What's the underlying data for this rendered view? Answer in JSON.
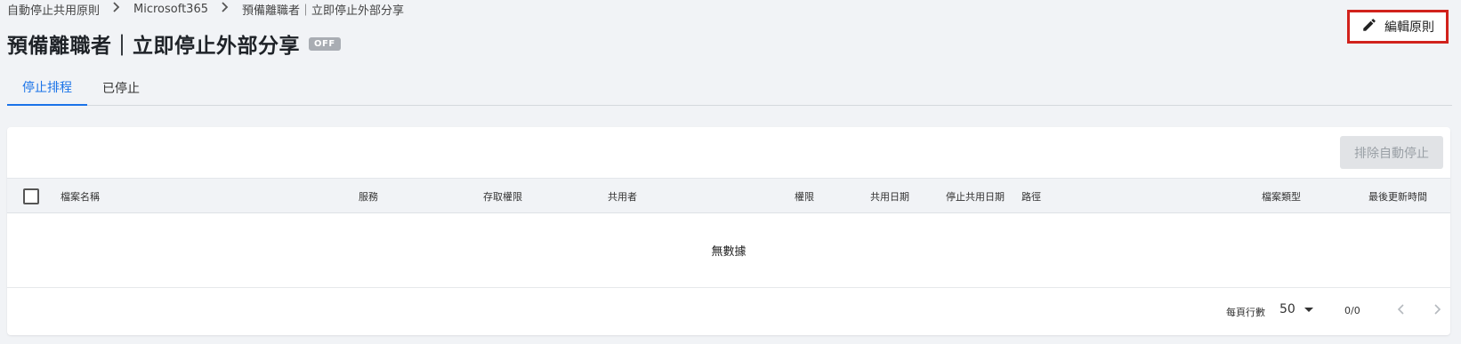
{
  "breadcrumb": {
    "items": [
      "自動停止共用原則",
      "Microsoft365",
      "預備離職者｜立即停止外部分享"
    ]
  },
  "header": {
    "title": "預備離職者｜立即停止外部分享",
    "status_badge": "OFF",
    "edit_button_label": "編輯原則"
  },
  "tabs": [
    {
      "label": "停止排程",
      "active": true
    },
    {
      "label": "已停止",
      "active": false
    }
  ],
  "toolbar": {
    "exclude_button_label": "排除自動停止"
  },
  "table": {
    "columns": [
      "檔案名稱",
      "服務",
      "存取權限",
      "共用者",
      "權限",
      "共用日期",
      "停止共用日期",
      "路徑",
      "檔案類型",
      "最後更新時間"
    ],
    "empty_text": "無數據"
  },
  "pagination": {
    "rows_per_page_label": "每頁行數",
    "rows_per_page_value": "50",
    "range_text": "0/0"
  },
  "colors": {
    "accent": "#1a73e8",
    "highlight_border": "#d1221c",
    "badge_bg": "#a9adb3"
  },
  "icons": {
    "edit": "pencil-icon",
    "breadcrumb_separator": "chevron-right-icon",
    "prev_page": "chevron-left-icon",
    "next_page": "chevron-right-icon",
    "dropdown": "caret-down-icon"
  }
}
